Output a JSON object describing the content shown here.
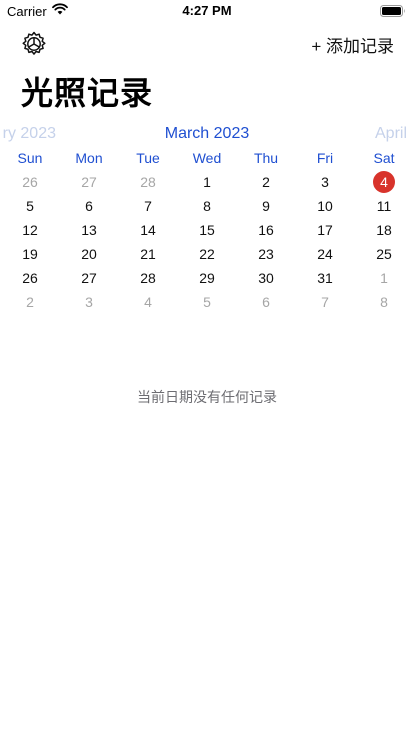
{
  "status": {
    "carrier": "Carrier",
    "time": "4:27 PM"
  },
  "header": {
    "add_label": "+ 添加记录",
    "title": "光照记录"
  },
  "calendar": {
    "prev_month": "ry 2023",
    "current_month": "March 2023",
    "next_month": "April",
    "weekdays": [
      "Sun",
      "Mon",
      "Tue",
      "Wed",
      "Thu",
      "Fri",
      "Sat"
    ],
    "weeks": [
      [
        {
          "d": "26",
          "m": true
        },
        {
          "d": "27",
          "m": true
        },
        {
          "d": "28",
          "m": true
        },
        {
          "d": "1"
        },
        {
          "d": "2"
        },
        {
          "d": "3"
        },
        {
          "d": "4",
          "sel": true
        }
      ],
      [
        {
          "d": "5"
        },
        {
          "d": "6"
        },
        {
          "d": "7"
        },
        {
          "d": "8"
        },
        {
          "d": "9"
        },
        {
          "d": "10"
        },
        {
          "d": "11"
        }
      ],
      [
        {
          "d": "12"
        },
        {
          "d": "13"
        },
        {
          "d": "14"
        },
        {
          "d": "15"
        },
        {
          "d": "16"
        },
        {
          "d": "17"
        },
        {
          "d": "18"
        }
      ],
      [
        {
          "d": "19"
        },
        {
          "d": "20"
        },
        {
          "d": "21"
        },
        {
          "d": "22"
        },
        {
          "d": "23"
        },
        {
          "d": "24"
        },
        {
          "d": "25"
        }
      ],
      [
        {
          "d": "26"
        },
        {
          "d": "27"
        },
        {
          "d": "28"
        },
        {
          "d": "29"
        },
        {
          "d": "30"
        },
        {
          "d": "31"
        },
        {
          "d": "1",
          "m": true
        }
      ],
      [
        {
          "d": "2",
          "m": true
        },
        {
          "d": "3",
          "m": true
        },
        {
          "d": "4",
          "m": true
        },
        {
          "d": "5",
          "m": true
        },
        {
          "d": "6",
          "m": true
        },
        {
          "d": "7",
          "m": true
        },
        {
          "d": "8",
          "m": true
        }
      ]
    ]
  },
  "empty_message": "当前日期没有任何记录",
  "colors": {
    "accent": "#1f4fd1",
    "selected": "#d8332b",
    "muted": "#a6a6a6"
  },
  "icons": {
    "settings": "gear-icon",
    "wifi": "wifi-icon",
    "battery": "battery-icon"
  }
}
